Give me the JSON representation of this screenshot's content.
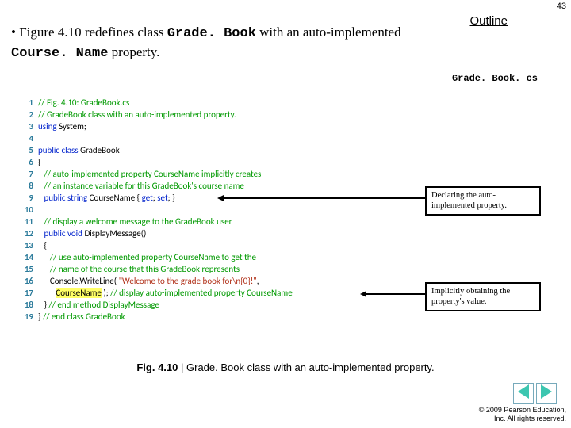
{
  "page_number": "43",
  "outline_label": "Outline",
  "bullet_leadin": "• Figure 4.10 redefines class ",
  "class_name": "Grade. Book",
  "bullet_mid": " with an auto-implemented ",
  "prop_name": "Course. Name",
  "bullet_end": " property.",
  "filename": "Grade. Book. cs",
  "code": [
    {
      "n": "1",
      "pre": "",
      "c": "// Fig. 4.10: GradeBook.cs"
    },
    {
      "n": "2",
      "pre": "",
      "c": "// GradeBook class with an auto-implemented property."
    },
    {
      "n": "3",
      "pre": "",
      "k": "using",
      "t": " System;"
    },
    {
      "n": "4",
      "pre": ""
    },
    {
      "n": "5",
      "pre": "",
      "k": "public class",
      "t": " GradeBook"
    },
    {
      "n": "6",
      "pre": "",
      "t": "{"
    },
    {
      "n": "7",
      "pre": "   ",
      "c": "// auto-implemented property CourseName implicitly creates"
    },
    {
      "n": "8",
      "pre": "   ",
      "c": "// an instance variable for this GradeBook's course name"
    },
    {
      "n": "9",
      "pre": "   ",
      "k": "public string",
      "t": " CourseName { ",
      "k2": "get",
      "t2": "; ",
      "k3": "set",
      "t3": "; }"
    },
    {
      "n": "10",
      "pre": ""
    },
    {
      "n": "11",
      "pre": "   ",
      "c": "// display a welcome message to the GradeBook user"
    },
    {
      "n": "12",
      "pre": "   ",
      "k": "public void",
      "t": " DisplayMessage()"
    },
    {
      "n": "13",
      "pre": "   ",
      "t": "{"
    },
    {
      "n": "14",
      "pre": "      ",
      "c": "// use auto-implemented property CourseName to get the"
    },
    {
      "n": "15",
      "pre": "      ",
      "c": "// name of the course that this GradeBook represents"
    },
    {
      "n": "16",
      "pre": "      ",
      "t": "Console.WriteLine( ",
      "s": "\"Welcome to the grade book for\\n{0}!\"",
      "t2": ","
    },
    {
      "n": "17",
      "pre": "         ",
      "hl": "CourseName",
      "t": " ); ",
      "c": "// display auto-implemented property CourseName"
    },
    {
      "n": "18",
      "pre": "   ",
      "t": "} ",
      "c": "// end method DisplayMessage"
    },
    {
      "n": "19",
      "pre": "",
      "t": "} ",
      "c": "// end class GradeBook"
    }
  ],
  "callout1": "Declaring the auto-implemented property.",
  "callout2": "Implicitly obtaining the property's value.",
  "caption_bold": "Fig. 4.10 ",
  "caption_sep": "| ",
  "caption_rest": "Grade. Book class with an auto-implemented property.",
  "copyright_l1": "© 2009 Pearson Education,",
  "copyright_l2": "Inc.  All rights reserved."
}
